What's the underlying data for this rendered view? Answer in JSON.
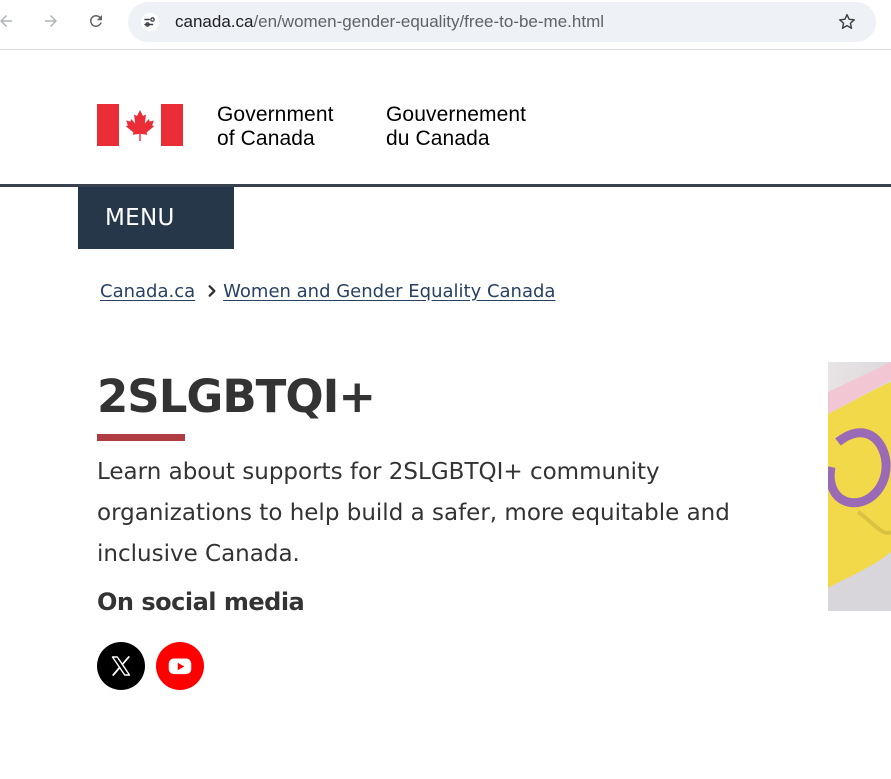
{
  "browser": {
    "url_host": "canada.ca",
    "url_path": "/en/women-gender-equality/free-to-be-me.html"
  },
  "header": {
    "signature_en_line1": "Government",
    "signature_en_line2": "of Canada",
    "signature_fr_line1": "Gouvernement",
    "signature_fr_line2": "du Canada",
    "menu_label": "MENU"
  },
  "breadcrumb": {
    "items": [
      {
        "label": "Canada.ca"
      },
      {
        "label": "Women and Gender Equality Canada"
      }
    ]
  },
  "main": {
    "title": "2SLGBTQI+",
    "intro": "Learn about supports for 2SLGBTQI+ community organizations to help build a safer, more equitable and inclusive Canada.",
    "social_heading": "On social media",
    "social_links": [
      {
        "icon": "x-icon"
      },
      {
        "icon": "youtube-icon"
      }
    ]
  },
  "colors": {
    "menu_bg": "#26374a",
    "link": "#284162",
    "title_accent": "#af3c43",
    "flag_red": "#eb2d37",
    "youtube_red": "#ff0000"
  }
}
